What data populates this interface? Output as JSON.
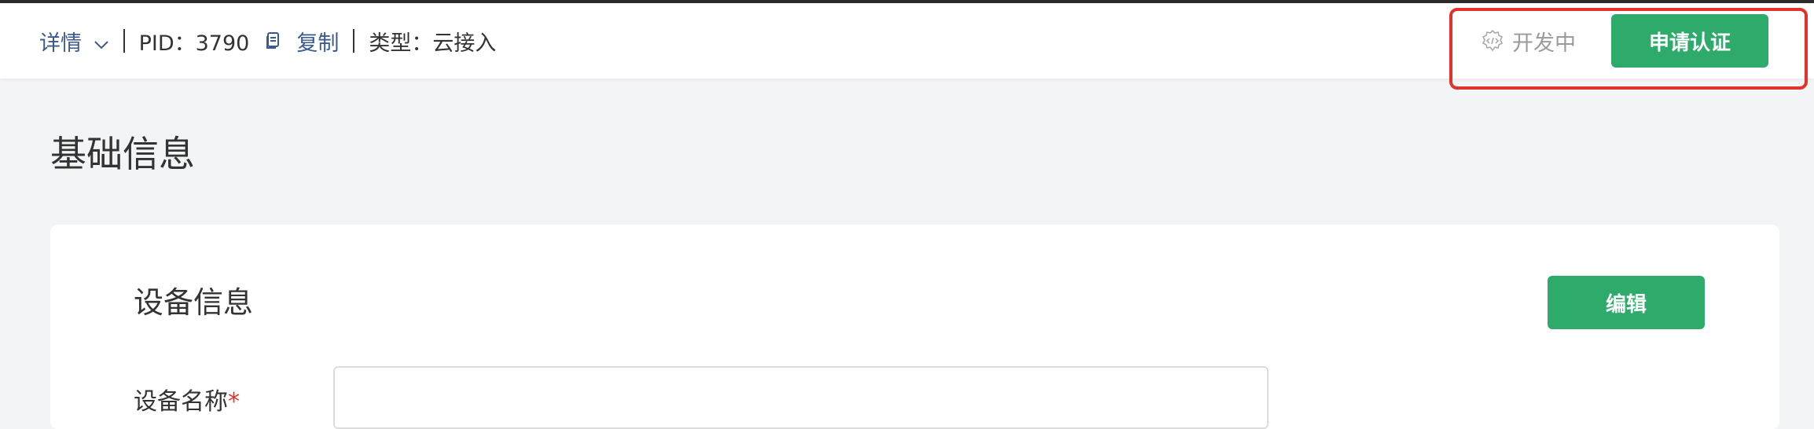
{
  "header": {
    "details_label": "详情",
    "pid_label": "PID：3790",
    "copy_label": "复制",
    "type_label": "类型：云接入"
  },
  "status": {
    "label": "开发中",
    "icon": "code-gear-icon"
  },
  "actions": {
    "apply_label": "申请认证",
    "edit_label": "编辑"
  },
  "page": {
    "title": "基础信息"
  },
  "card": {
    "title": "设备信息",
    "field_label": "设备名称",
    "required_mark": "*",
    "field_value": ""
  },
  "colors": {
    "accent": "#2eaa6b",
    "link": "#3a5a8c",
    "highlight": "#e2332a"
  }
}
